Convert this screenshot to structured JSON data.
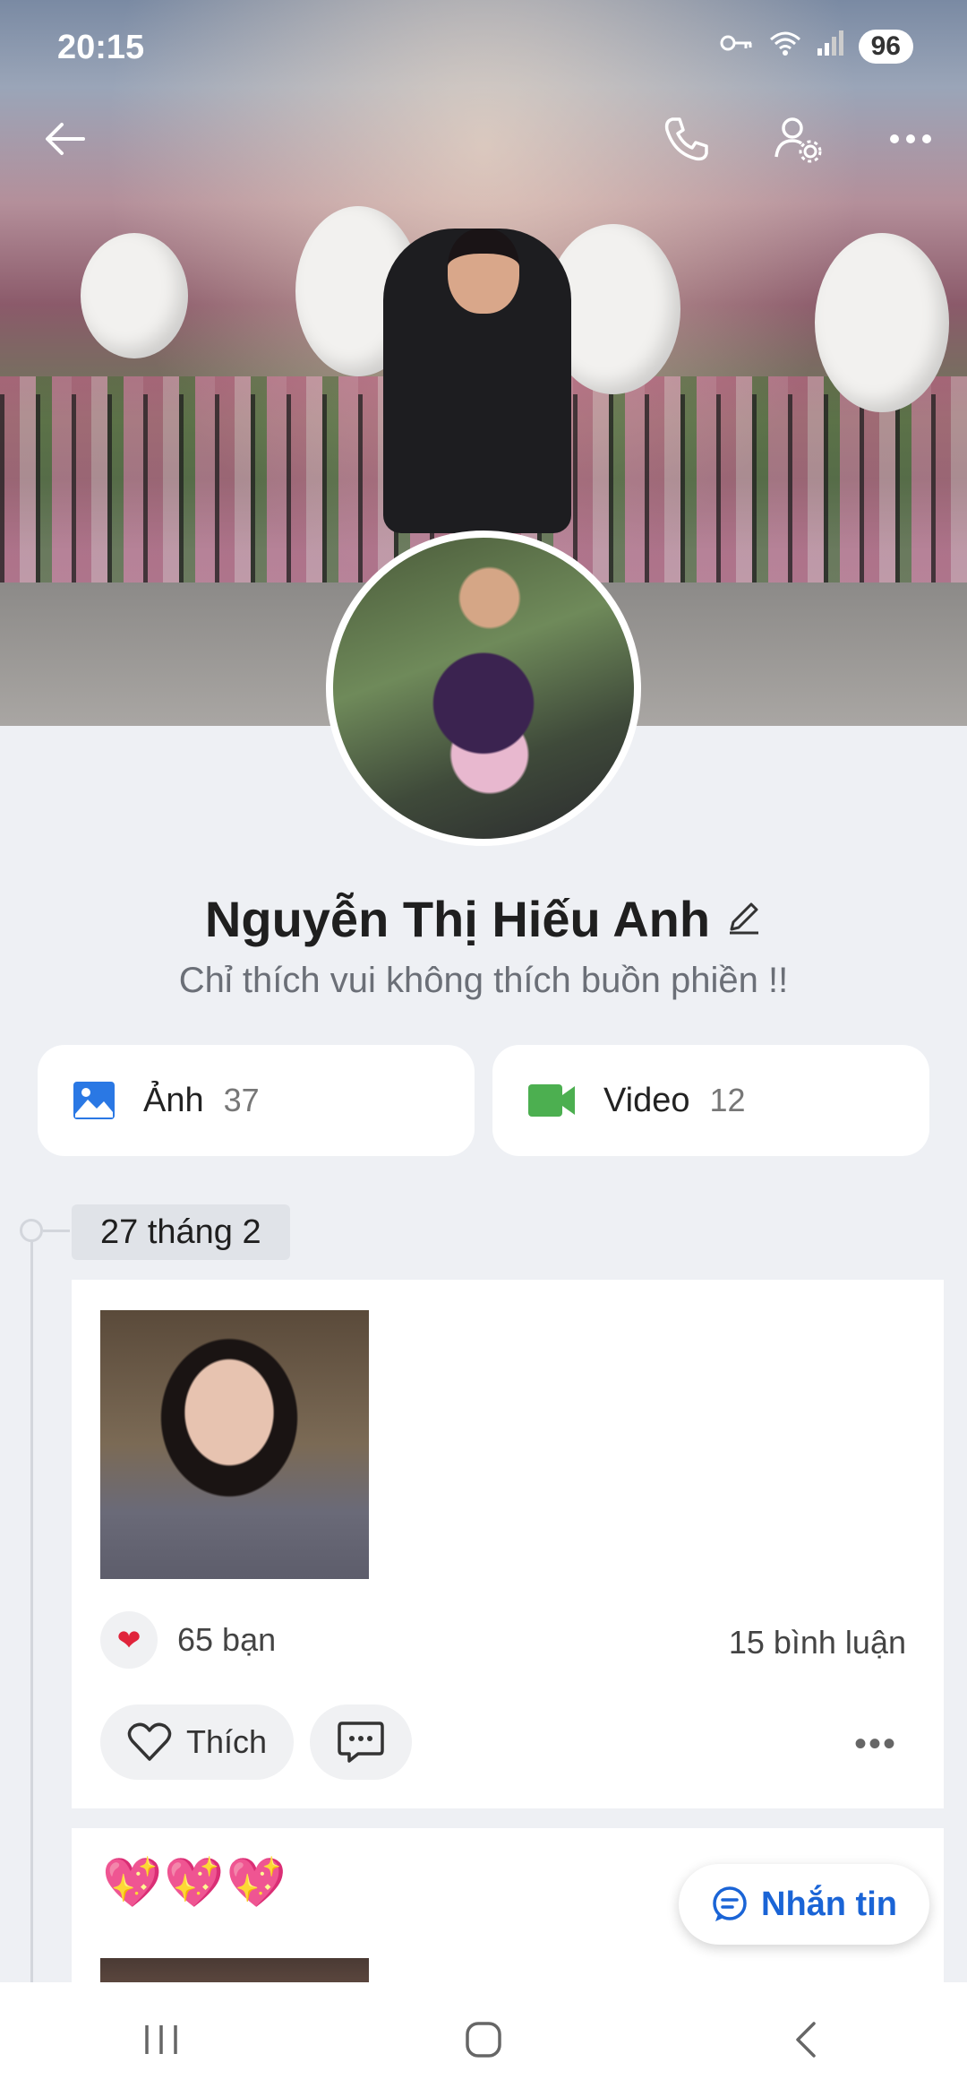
{
  "status_bar": {
    "time": "20:15",
    "battery": "96"
  },
  "profile": {
    "name": "Nguyễn Thị Hiếu Anh",
    "status": "Chỉ thích vui không thích buồn phiền !!"
  },
  "media": {
    "photos": {
      "label": "Ảnh",
      "count": "37"
    },
    "videos": {
      "label": "Video",
      "count": "12"
    }
  },
  "timeline": {
    "date": "27 tháng 2",
    "post": {
      "reactions_count": "65 bạn",
      "comments": "15 bình luận",
      "like_label": "Thích"
    },
    "post2": {
      "text": "💖💖💖"
    }
  },
  "message_button": {
    "label": "Nhắn tin"
  },
  "colors": {
    "accent": "#1a64d6",
    "video_icon": "#4caf50",
    "photo_icon": "#2a78e4",
    "heart": "#e0243b"
  }
}
